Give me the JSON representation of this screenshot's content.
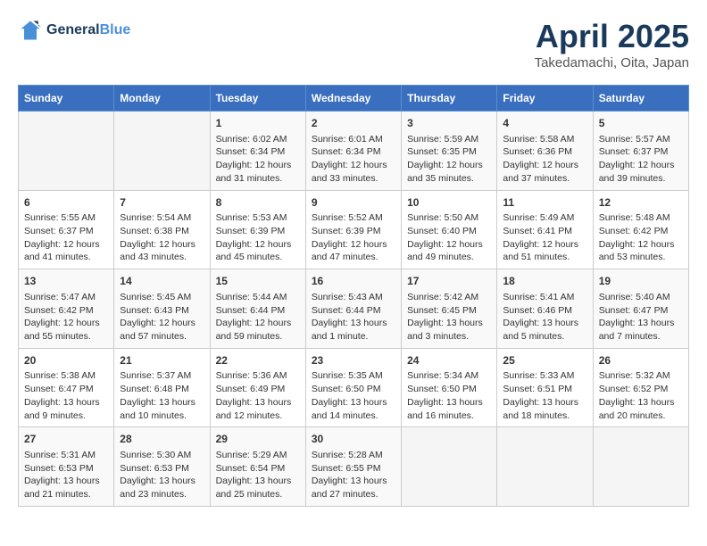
{
  "logo": {
    "line1": "General",
    "line2": "Blue"
  },
  "title": "April 2025",
  "subtitle": "Takedamachi, Oita, Japan",
  "days_of_week": [
    "Sunday",
    "Monday",
    "Tuesday",
    "Wednesday",
    "Thursday",
    "Friday",
    "Saturday"
  ],
  "weeks": [
    [
      {
        "day": "",
        "info": ""
      },
      {
        "day": "",
        "info": ""
      },
      {
        "day": "1",
        "info": "Sunrise: 6:02 AM\nSunset: 6:34 PM\nDaylight: 12 hours\nand 31 minutes."
      },
      {
        "day": "2",
        "info": "Sunrise: 6:01 AM\nSunset: 6:34 PM\nDaylight: 12 hours\nand 33 minutes."
      },
      {
        "day": "3",
        "info": "Sunrise: 5:59 AM\nSunset: 6:35 PM\nDaylight: 12 hours\nand 35 minutes."
      },
      {
        "day": "4",
        "info": "Sunrise: 5:58 AM\nSunset: 6:36 PM\nDaylight: 12 hours\nand 37 minutes."
      },
      {
        "day": "5",
        "info": "Sunrise: 5:57 AM\nSunset: 6:37 PM\nDaylight: 12 hours\nand 39 minutes."
      }
    ],
    [
      {
        "day": "6",
        "info": "Sunrise: 5:55 AM\nSunset: 6:37 PM\nDaylight: 12 hours\nand 41 minutes."
      },
      {
        "day": "7",
        "info": "Sunrise: 5:54 AM\nSunset: 6:38 PM\nDaylight: 12 hours\nand 43 minutes."
      },
      {
        "day": "8",
        "info": "Sunrise: 5:53 AM\nSunset: 6:39 PM\nDaylight: 12 hours\nand 45 minutes."
      },
      {
        "day": "9",
        "info": "Sunrise: 5:52 AM\nSunset: 6:39 PM\nDaylight: 12 hours\nand 47 minutes."
      },
      {
        "day": "10",
        "info": "Sunrise: 5:50 AM\nSunset: 6:40 PM\nDaylight: 12 hours\nand 49 minutes."
      },
      {
        "day": "11",
        "info": "Sunrise: 5:49 AM\nSunset: 6:41 PM\nDaylight: 12 hours\nand 51 minutes."
      },
      {
        "day": "12",
        "info": "Sunrise: 5:48 AM\nSunset: 6:42 PM\nDaylight: 12 hours\nand 53 minutes."
      }
    ],
    [
      {
        "day": "13",
        "info": "Sunrise: 5:47 AM\nSunset: 6:42 PM\nDaylight: 12 hours\nand 55 minutes."
      },
      {
        "day": "14",
        "info": "Sunrise: 5:45 AM\nSunset: 6:43 PM\nDaylight: 12 hours\nand 57 minutes."
      },
      {
        "day": "15",
        "info": "Sunrise: 5:44 AM\nSunset: 6:44 PM\nDaylight: 12 hours\nand 59 minutes."
      },
      {
        "day": "16",
        "info": "Sunrise: 5:43 AM\nSunset: 6:44 PM\nDaylight: 13 hours\nand 1 minute."
      },
      {
        "day": "17",
        "info": "Sunrise: 5:42 AM\nSunset: 6:45 PM\nDaylight: 13 hours\nand 3 minutes."
      },
      {
        "day": "18",
        "info": "Sunrise: 5:41 AM\nSunset: 6:46 PM\nDaylight: 13 hours\nand 5 minutes."
      },
      {
        "day": "19",
        "info": "Sunrise: 5:40 AM\nSunset: 6:47 PM\nDaylight: 13 hours\nand 7 minutes."
      }
    ],
    [
      {
        "day": "20",
        "info": "Sunrise: 5:38 AM\nSunset: 6:47 PM\nDaylight: 13 hours\nand 9 minutes."
      },
      {
        "day": "21",
        "info": "Sunrise: 5:37 AM\nSunset: 6:48 PM\nDaylight: 13 hours\nand 10 minutes."
      },
      {
        "day": "22",
        "info": "Sunrise: 5:36 AM\nSunset: 6:49 PM\nDaylight: 13 hours\nand 12 minutes."
      },
      {
        "day": "23",
        "info": "Sunrise: 5:35 AM\nSunset: 6:50 PM\nDaylight: 13 hours\nand 14 minutes."
      },
      {
        "day": "24",
        "info": "Sunrise: 5:34 AM\nSunset: 6:50 PM\nDaylight: 13 hours\nand 16 minutes."
      },
      {
        "day": "25",
        "info": "Sunrise: 5:33 AM\nSunset: 6:51 PM\nDaylight: 13 hours\nand 18 minutes."
      },
      {
        "day": "26",
        "info": "Sunrise: 5:32 AM\nSunset: 6:52 PM\nDaylight: 13 hours\nand 20 minutes."
      }
    ],
    [
      {
        "day": "27",
        "info": "Sunrise: 5:31 AM\nSunset: 6:53 PM\nDaylight: 13 hours\nand 21 minutes."
      },
      {
        "day": "28",
        "info": "Sunrise: 5:30 AM\nSunset: 6:53 PM\nDaylight: 13 hours\nand 23 minutes."
      },
      {
        "day": "29",
        "info": "Sunrise: 5:29 AM\nSunset: 6:54 PM\nDaylight: 13 hours\nand 25 minutes."
      },
      {
        "day": "30",
        "info": "Sunrise: 5:28 AM\nSunset: 6:55 PM\nDaylight: 13 hours\nand 27 minutes."
      },
      {
        "day": "",
        "info": ""
      },
      {
        "day": "",
        "info": ""
      },
      {
        "day": "",
        "info": ""
      }
    ]
  ]
}
